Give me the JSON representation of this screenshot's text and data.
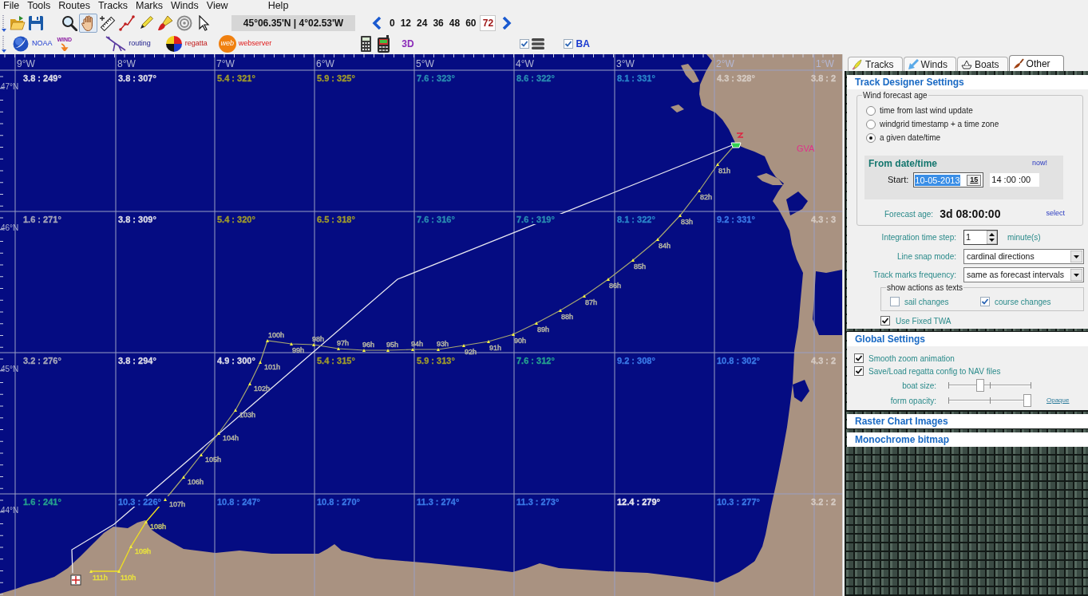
{
  "menu": [
    "File",
    "Tools",
    "Routes",
    "Tracks",
    "Marks",
    "Winds",
    "View",
    "Help"
  ],
  "toolbar": {
    "file_buttons": [
      {
        "kind": "open"
      },
      {
        "kind": "save"
      }
    ],
    "map_tools": [
      {
        "kind": "zoom",
        "selected": false
      },
      {
        "kind": "pan",
        "selected": true
      },
      {
        "kind": "measure",
        "selected": false
      },
      {
        "kind": "route",
        "selected": false
      },
      {
        "kind": "pen",
        "selected": false
      },
      {
        "kind": "brush",
        "selected": false
      },
      {
        "kind": "target",
        "selected": false
      },
      {
        "kind": "pointer",
        "selected": false
      }
    ],
    "position": "45°06.35'N | 4°02.53'W",
    "forecast_hours": [
      {
        "label": "0",
        "selected": false
      },
      {
        "label": "12",
        "selected": false
      },
      {
        "label": "24",
        "selected": false
      },
      {
        "label": "36",
        "selected": false
      },
      {
        "label": "48",
        "selected": false
      },
      {
        "label": "60",
        "selected": false
      },
      {
        "label": "72",
        "selected": true
      }
    ]
  },
  "toolbar2": {
    "plugins": [
      {
        "kind": "noaa",
        "label": "NOAA"
      },
      {
        "kind": "wind",
        "label": "WIND"
      },
      {
        "kind": "routing",
        "label": "routing"
      },
      {
        "kind": "regatta",
        "label": "regatta"
      },
      {
        "kind": "web",
        "logo": "web",
        "label": "webserver"
      }
    ],
    "devices": [
      {
        "kind": "calculator"
      },
      {
        "kind": "phone"
      }
    ],
    "view_3d": "3D",
    "toggles": [
      {
        "kind": "layers",
        "checked": true
      },
      {
        "kind": "text",
        "label": "BA",
        "checked": true
      }
    ]
  },
  "map": {
    "longitudes": [
      "9°W",
      "8°W",
      "7°W",
      "6°W",
      "5°W",
      "4°W",
      "3°W",
      "2°W",
      "1°W"
    ],
    "latitudes": [
      "47°N",
      "46°N",
      "45°N",
      "44°N"
    ],
    "wind_rows": [
      {
        "labels": [
          {
            "text": "3.8 : 249°",
            "color": "#dcdce6"
          },
          {
            "text": "3.8 : 307°",
            "color": "#dcdce6"
          },
          {
            "text": "5.4 : 321°",
            "color": "#9e9a2c"
          },
          {
            "text": "5.9 : 325°",
            "color": "#9e9a2c"
          },
          {
            "text": "7.6 : 323°",
            "color": "#2a8cb0"
          },
          {
            "text": "8.6 : 322°",
            "color": "#2a8cb0"
          },
          {
            "text": "8.1 : 331°",
            "color": "#2a84c8"
          },
          {
            "text": "4.3 : 328°",
            "color": "#d6cbc3"
          },
          {
            "text": "3.8 : 2",
            "color": "#d6cbc3"
          }
        ]
      },
      {
        "labels": [
          {
            "text": "1.6 : 271°",
            "color": "#a4a4b8"
          },
          {
            "text": "3.8 : 309°",
            "color": "#dcdce6"
          },
          {
            "text": "5.4 : 320°",
            "color": "#9e9a2c"
          },
          {
            "text": "6.5 : 318°",
            "color": "#9e9a2c"
          },
          {
            "text": "7.6 : 316°",
            "color": "#2a8cb0"
          },
          {
            "text": "7.6 : 319°",
            "color": "#2a8cb0"
          },
          {
            "text": "8.1 : 322°",
            "color": "#2a84c8"
          },
          {
            "text": "9.2 : 331°",
            "color": "#3a78e6"
          },
          {
            "text": "4.3 : 3",
            "color": "#d6cbc3"
          }
        ]
      },
      {
        "labels": [
          {
            "text": "3.2 : 276°",
            "color": "#a4a4b8"
          },
          {
            "text": "3.8 : 294°",
            "color": "#dcdce6"
          },
          {
            "text": "4.9 : 300°",
            "color": "#dcdce6"
          },
          {
            "text": "5.4 : 315°",
            "color": "#9e9a2c"
          },
          {
            "text": "5.9 : 313°",
            "color": "#9e9a2c"
          },
          {
            "text": "7.6 : 312°",
            "color": "#26a08e"
          },
          {
            "text": "9.2 : 308°",
            "color": "#3a78e6"
          },
          {
            "text": "10.8 : 302°",
            "color": "#3a78e6"
          },
          {
            "text": "4.3 : 2",
            "color": "#d6cbc3"
          }
        ]
      },
      {
        "labels": [
          {
            "text": "1.6 : 241°",
            "color": "#26a08e"
          },
          {
            "text": "10.3 : 226°",
            "color": "#3a78e6"
          },
          {
            "text": "10.8 : 247°",
            "color": "#3a78e6"
          },
          {
            "text": "10.8 : 270°",
            "color": "#3a78e6"
          },
          {
            "text": "11.3 : 274°",
            "color": "#3a78e6"
          },
          {
            "text": "11.3 : 273°",
            "color": "#3a78e6"
          },
          {
            "text": "12.4 : 279°",
            "color": "#e8e8f0"
          },
          {
            "text": "10.3 : 277°",
            "color": "#3a78e6"
          },
          {
            "text": "3.2 : 2",
            "color": "#d6cbc3"
          }
        ]
      }
    ],
    "track_marks": [
      {
        "label": "111h",
        "color": "#e8e040"
      },
      {
        "label": "110h",
        "color": "#e8e040"
      },
      {
        "label": "109h",
        "color": "#e8e040"
      },
      {
        "label": "108h",
        "color": "#c8c870"
      },
      {
        "label": "107h",
        "color": "#b8b8a4"
      },
      {
        "label": "106h",
        "color": "#b8b8a4"
      },
      {
        "label": "105h",
        "color": "#b8b8a4"
      },
      {
        "label": "104h",
        "color": "#b8b8a4"
      },
      {
        "label": "103h",
        "color": "#b8b8a4"
      },
      {
        "label": "102h",
        "color": "#b8b8a4"
      },
      {
        "label": "101h",
        "color": "#b8b8a4"
      },
      {
        "label": "100h",
        "color": "#b8b8a4"
      },
      {
        "label": "99h",
        "color": "#b8b8a4"
      },
      {
        "label": "98h",
        "color": "#b8b8a4"
      },
      {
        "label": "97h",
        "color": "#b8b8a4"
      },
      {
        "label": "96h",
        "color": "#b8b8a4"
      },
      {
        "label": "95h",
        "color": "#b8b8a4"
      },
      {
        "label": "94h",
        "color": "#b8b8a4"
      },
      {
        "label": "93h",
        "color": "#b8b8a4"
      },
      {
        "label": "92h",
        "color": "#b8b8a4"
      },
      {
        "label": "91h",
        "color": "#b8b8a4"
      },
      {
        "label": "90h",
        "color": "#b8b8a4"
      },
      {
        "label": "89h",
        "color": "#b8b8a4"
      },
      {
        "label": "88h",
        "color": "#b8b8a4"
      },
      {
        "label": "87h",
        "color": "#b8b8a4"
      },
      {
        "label": "86h",
        "color": "#b8b8a4"
      },
      {
        "label": "85h",
        "color": "#b8b8a4"
      },
      {
        "label": "84h",
        "color": "#b8b8a4"
      },
      {
        "label": "83h",
        "color": "#b8b8a4"
      },
      {
        "label": "82h",
        "color": "#b8b8a4"
      },
      {
        "label": "81h",
        "color": "#b8b8a4"
      }
    ],
    "finish_label": "GVA"
  },
  "panel": {
    "tabs": [
      {
        "label": "Tracks",
        "kind": "tracks",
        "selected": false
      },
      {
        "label": "Winds",
        "kind": "winds",
        "selected": false
      },
      {
        "label": "Boats",
        "kind": "boats",
        "selected": false
      },
      {
        "label": "Other",
        "kind": "other",
        "selected": true
      }
    ],
    "track_designer": {
      "title": "Track Designer Settings",
      "forecast_age_group": {
        "legend": "Wind forecast age",
        "options": [
          {
            "label": "time from last wind update",
            "selected": false
          },
          {
            "label": "windgrid timestamp + a time zone",
            "selected": false
          },
          {
            "label": "a given date/time",
            "selected": true
          }
        ],
        "from": {
          "title": "From date/time",
          "now_link": "now!",
          "start_label": "Start:",
          "date": "10-05-2013",
          "calendar_button": "15",
          "time": "14 :00 :00"
        },
        "age_label": "Forecast age:",
        "age_value": "3d 08:00:00",
        "select_link": "select"
      },
      "integration": {
        "label": "Integration time step:",
        "value": "1",
        "unit": "minute(s)"
      },
      "dropdowns": [
        {
          "label": "Line snap mode:",
          "value": "cardinal directions"
        },
        {
          "label": "Track marks frequency:",
          "value": "same as forecast intervals"
        }
      ],
      "show_actions": {
        "legend": "show actions as texts",
        "options": [
          {
            "label": "sail changes",
            "checked": false
          },
          {
            "label": "course changes",
            "checked": true
          }
        ]
      },
      "fixed_twa": {
        "label": "Use Fixed TWA",
        "checked": true
      }
    },
    "global_settings": {
      "title": "Global Settings",
      "checkboxes": [
        {
          "label": "Smooth zoom animation",
          "checked": true
        },
        {
          "label": "Save/Load regatta config to NAV files",
          "checked": true
        }
      ],
      "sliders": [
        {
          "label": "boat size:",
          "level": 0.37
        },
        {
          "label": "form opacity:",
          "level": 1,
          "link": "Opaque"
        }
      ]
    },
    "collapsed_sections": [
      "Raster Chart Images",
      "Monochrome bitmap"
    ]
  }
}
